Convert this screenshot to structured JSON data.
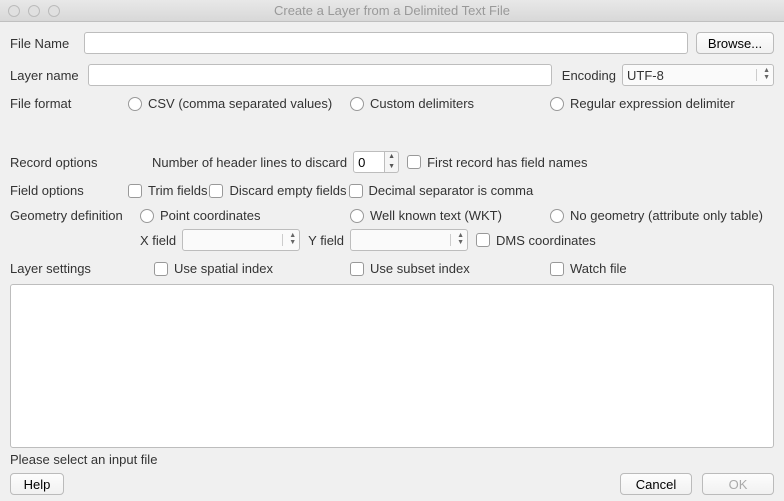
{
  "window": {
    "title": "Create a Layer from a Delimited Text File"
  },
  "fileRow": {
    "label": "File Name",
    "value": "",
    "browse": "Browse..."
  },
  "layerRow": {
    "label": "Layer name",
    "value": "",
    "encodingLabel": "Encoding",
    "encodingValue": "UTF-8"
  },
  "fileFormat": {
    "label": "File format",
    "csv": "CSV (comma separated values)",
    "custom": "Custom delimiters",
    "regex": "Regular expression delimiter"
  },
  "recordOptions": {
    "label": "Record options",
    "numHeader": "Number of header lines to discard",
    "numHeaderValue": "0",
    "firstRecord": "First record has field names"
  },
  "fieldOptions": {
    "label": "Field options",
    "trim": "Trim fields",
    "discardEmpty": "Discard empty fields",
    "decimalComma": "Decimal separator is comma"
  },
  "geom": {
    "label": "Geometry definition",
    "point": "Point coordinates",
    "wkt": "Well known text (WKT)",
    "none": "No geometry (attribute only table)",
    "xfield": "X field",
    "xfieldValue": "",
    "yfield": "Y field",
    "yfieldValue": "",
    "dms": "DMS coordinates"
  },
  "layerSettings": {
    "label": "Layer settings",
    "spatial": "Use spatial index",
    "subset": "Use subset index",
    "watch": "Watch file"
  },
  "status": "Please select an input file",
  "buttons": {
    "help": "Help",
    "cancel": "Cancel",
    "ok": "OK"
  }
}
